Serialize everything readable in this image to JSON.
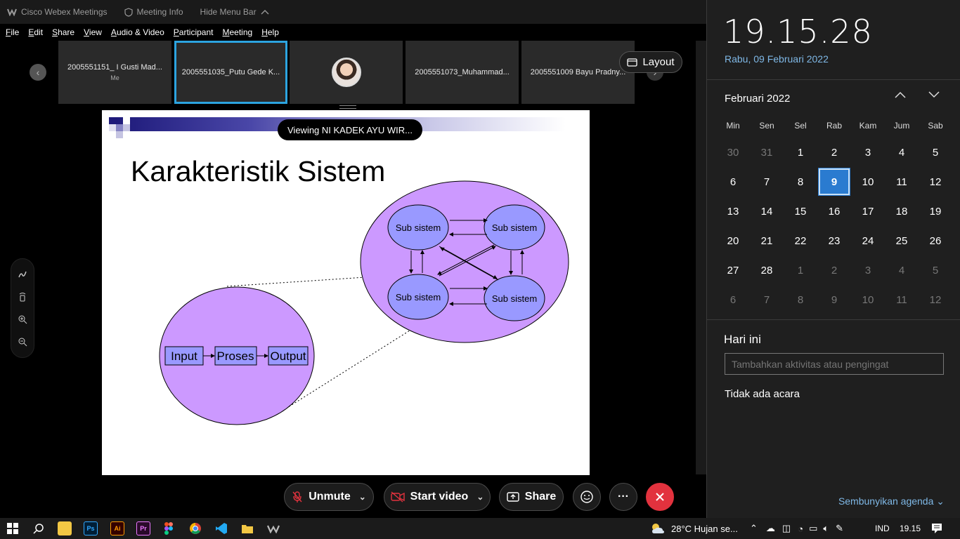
{
  "titlebar": {
    "app_name": "Cisco Webex Meetings",
    "meeting_info": "Meeting Info",
    "hide_menu_bar": "Hide Menu Bar"
  },
  "menubar": [
    "File",
    "Edit",
    "Share",
    "View",
    "Audio & Video",
    "Participant",
    "Meeting",
    "Help"
  ],
  "participants": [
    {
      "name": "2005551151_ I Gusti Mad...",
      "sub": "Me"
    },
    {
      "name": "2005551035_Putu Gede K...",
      "sub": ""
    },
    {
      "name": "",
      "sub": ""
    },
    {
      "name": "2005551073_Muhammad...",
      "sub": ""
    },
    {
      "name": "2005551009 Bayu Pradny...",
      "sub": ""
    }
  ],
  "layout_label": "Layout",
  "viewing_label": "Viewing NI KADEK AYU WIR...",
  "slide": {
    "title": "Karakteristik Sistem",
    "subsystems": [
      "Sub sistem",
      "Sub sistem",
      "Sub sistem",
      "Sub sistem"
    ],
    "flow": [
      "Input",
      "Proses",
      "Output"
    ]
  },
  "controls": {
    "unmute": "Unmute",
    "start_video": "Start video",
    "share": "Share",
    "more": "···"
  },
  "calendar": {
    "time": "19.15.28",
    "long_date": "Rabu, 09 Februari 2022",
    "month_label": "Februari 2022",
    "weekdays": [
      "Min",
      "Sen",
      "Sel",
      "Rab",
      "Kam",
      "Jum",
      "Sab"
    ],
    "weeks": [
      [
        "30",
        "31",
        "1",
        "2",
        "3",
        "4",
        "5"
      ],
      [
        "6",
        "7",
        "8",
        "9",
        "10",
        "11",
        "12"
      ],
      [
        "13",
        "14",
        "15",
        "16",
        "17",
        "18",
        "19"
      ],
      [
        "20",
        "21",
        "22",
        "23",
        "24",
        "25",
        "26"
      ],
      [
        "27",
        "28",
        "1",
        "2",
        "3",
        "4",
        "5"
      ],
      [
        "6",
        "7",
        "8",
        "9",
        "10",
        "11",
        "12"
      ]
    ],
    "today": "9",
    "agenda_title": "Hari ini",
    "add_placeholder": "Tambahkan aktivitas atau pengingat",
    "no_events": "Tidak ada acara",
    "hide_agenda": "Sembunyikan agenda"
  },
  "taskbar": {
    "weather": "28°C  Hujan se...",
    "language": "IND",
    "time": "19.15"
  },
  "colors": {
    "accent": "#2ca4e0",
    "today_bg": "#2a7bd0",
    "end_call": "#e2323e",
    "bubble": "#cc99ff",
    "subsystem": "#9999ff"
  }
}
